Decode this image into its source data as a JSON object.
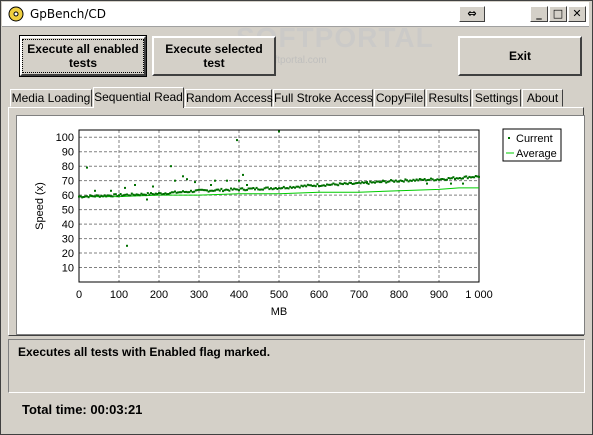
{
  "window": {
    "title": "GpBench/CD"
  },
  "buttons": {
    "execute_all": "Execute all enabled tests",
    "execute_selected": "Execute selected test",
    "exit": "Exit"
  },
  "watermark": {
    "brand": "SOFTPORTAL",
    "url": "www.softportal.com"
  },
  "tabs": [
    {
      "label": "Media Loading",
      "active": false
    },
    {
      "label": "Sequential Read",
      "active": true
    },
    {
      "label": "Random Access",
      "active": false
    },
    {
      "label": "Full Stroke Access",
      "active": false
    },
    {
      "label": "CopyFile",
      "active": false
    },
    {
      "label": "Results",
      "active": false
    },
    {
      "label": "Settings",
      "active": false
    },
    {
      "label": "About",
      "active": false
    }
  ],
  "chart_data": {
    "type": "scatter",
    "xlabel": "MB",
    "ylabel": "Speed (x)",
    "xlim": [
      0,
      1000
    ],
    "ylim": [
      0,
      105
    ],
    "x_ticks": [
      "0",
      "100",
      "200",
      "300",
      "400",
      "500",
      "600",
      "700",
      "800",
      "900",
      "1 000"
    ],
    "y_ticks": [
      "10",
      "20",
      "30",
      "40",
      "50",
      "60",
      "70",
      "80",
      "90",
      "100"
    ],
    "grid": true,
    "legend_position": "top-right",
    "series": [
      {
        "name": "Current",
        "style": "points",
        "color": "#007000",
        "trend": [
          [
            0,
            59
          ],
          [
            100,
            60
          ],
          [
            200,
            61
          ],
          [
            300,
            63
          ],
          [
            400,
            64
          ],
          [
            500,
            65
          ],
          [
            600,
            67
          ],
          [
            700,
            68
          ],
          [
            800,
            70
          ],
          [
            900,
            71
          ],
          [
            1000,
            73
          ]
        ],
        "outliers": [
          [
            20,
            79
          ],
          [
            40,
            63
          ],
          [
            80,
            63
          ],
          [
            115,
            65
          ],
          [
            120,
            25
          ],
          [
            140,
            67
          ],
          [
            170,
            57
          ],
          [
            185,
            66
          ],
          [
            230,
            80
          ],
          [
            240,
            70
          ],
          [
            260,
            73
          ],
          [
            270,
            71
          ],
          [
            290,
            69
          ],
          [
            330,
            67
          ],
          [
            340,
            70
          ],
          [
            370,
            70
          ],
          [
            395,
            98
          ],
          [
            400,
            70
          ],
          [
            410,
            74
          ],
          [
            420,
            67
          ],
          [
            500,
            104
          ],
          [
            720,
            69
          ],
          [
            760,
            70
          ],
          [
            870,
            68
          ],
          [
            930,
            68
          ],
          [
            960,
            68
          ]
        ]
      },
      {
        "name": "Average",
        "style": "line",
        "color": "#00cc00",
        "points": [
          [
            0,
            59
          ],
          [
            100,
            59
          ],
          [
            200,
            60
          ],
          [
            300,
            60
          ],
          [
            400,
            61
          ],
          [
            500,
            61
          ],
          [
            600,
            62
          ],
          [
            700,
            62
          ],
          [
            800,
            63
          ],
          [
            900,
            64
          ],
          [
            950,
            65
          ],
          [
            1000,
            65
          ]
        ]
      }
    ]
  },
  "status": {
    "message": "Executes all tests with Enabled flag marked.",
    "total_time": "Total time: 00:03:21"
  }
}
